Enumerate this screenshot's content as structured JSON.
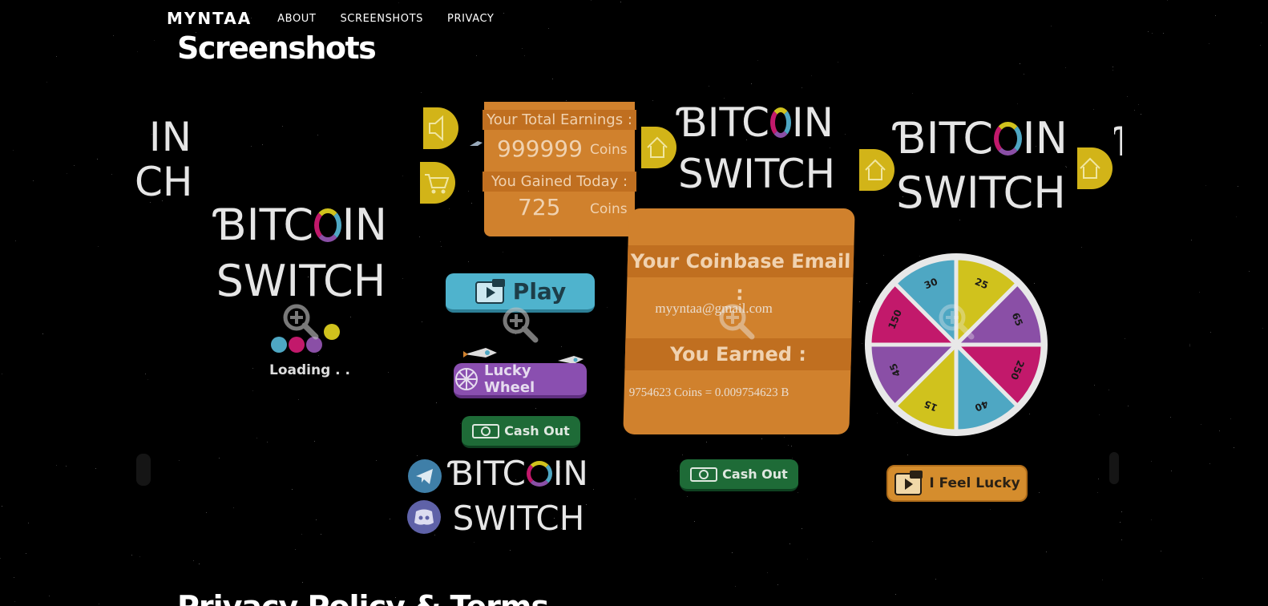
{
  "nav": {
    "brand": "MYNTAA",
    "links": [
      "ABOUT",
      "SCREENSHOTS",
      "PRIVACY"
    ]
  },
  "page_title": "Screenshots",
  "next_section_title": "Privacy Policy & Terms",
  "logo": {
    "line1_before": "ƁITC",
    "line1_after": "IN",
    "line2": "SWITCH",
    "partial_top": "IN",
    "partial_bottom": "CH"
  },
  "loading_screen": {
    "text": "Loading . ."
  },
  "menu_screen": {
    "total_label": "Your Total Earnings :",
    "total_value": "999999",
    "total_unit": "Coins",
    "today_label": "You Gained Today :",
    "today_value": "725",
    "today_unit": "Coins",
    "play_label": "Play",
    "lucky_wheel_label": "Lucky Wheel",
    "cash_out_label": "Cash Out"
  },
  "cashout_screen": {
    "email_label": "Your Coinbase Email :",
    "email_value": "myyntaa@gmail.com",
    "earned_label": "You Earned :",
    "earned_value": "9754623 Coins = 0.009754623 B",
    "cash_out_label": "Cash Out"
  },
  "wheel_screen": {
    "segments": [
      "25",
      "65",
      "250",
      "40",
      "15",
      "45",
      "150",
      "30"
    ],
    "feel_lucky_label": "I Feel Lucky"
  },
  "colors": {
    "orange": "#d0812d",
    "orange_dark": "#c06f20",
    "blue": "#4fb3cd",
    "purple": "#8a4fb0",
    "green": "#1e6b37",
    "pink": "#c2196b",
    "yellow": "#d0c21d"
  },
  "icons": [
    "sound-icon",
    "cart-icon",
    "home-icon",
    "ad-video-icon",
    "wheel-icon",
    "cash-icon",
    "telegram-icon",
    "discord-icon",
    "zoom-icon",
    "rocket-icon"
  ]
}
